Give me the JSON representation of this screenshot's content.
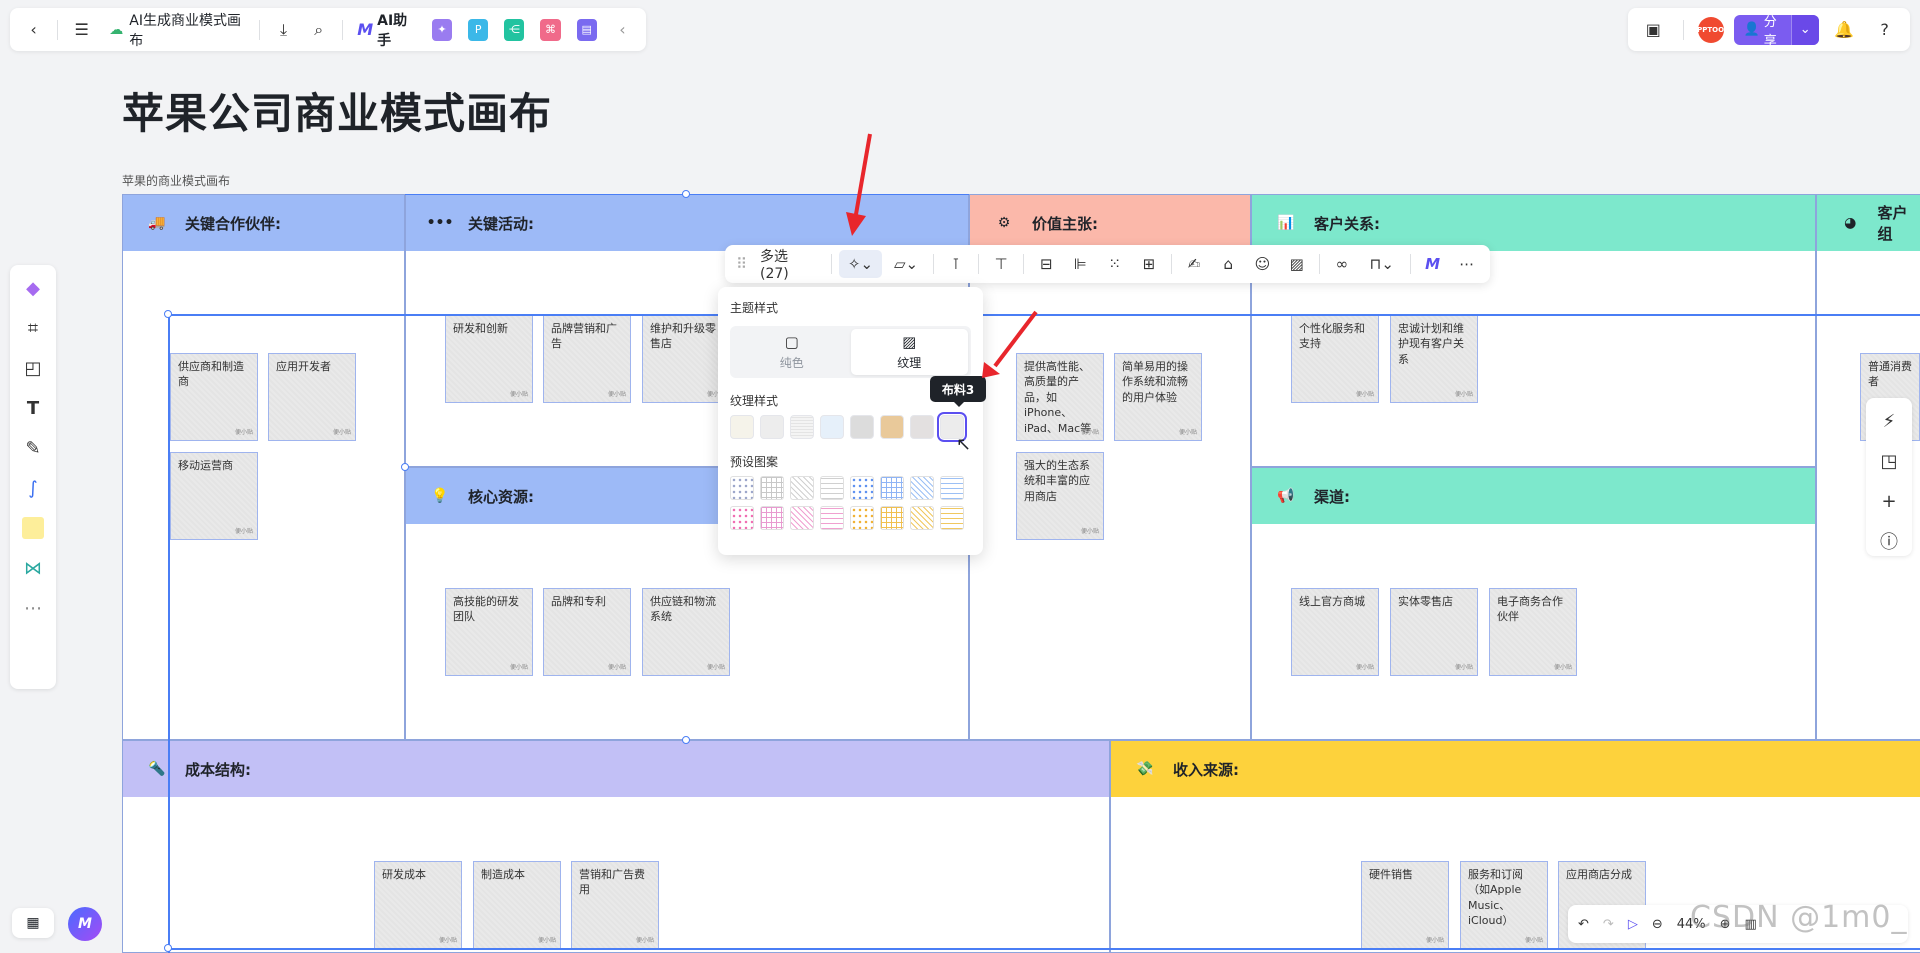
{
  "topbar": {
    "doc_title": "AI生成商业模式画布",
    "ai_label": "AI助手",
    "share_label": "分享",
    "avatar_text": "PPTOO"
  },
  "canvas": {
    "title": "苹果公司商业模式画布",
    "caption": "苹果的商业模式画布",
    "sections": {
      "partners": "关键合作伙伴:",
      "activities": "关键活动:",
      "value": "价值主张:",
      "relations": "客户关系:",
      "segments": "客户组",
      "resources": "核心资源:",
      "channels": "渠道:",
      "cost": "成本结构:",
      "revenue": "收入来源:"
    },
    "notes": {
      "n1": "供应商和制造商",
      "n2": "应用开发者",
      "n3": "移动运营商",
      "n4": "研发和创新",
      "n5": "品牌营销和广告",
      "n6": "维护和升级零售店",
      "n7": "高技能的研发团队",
      "n8": "品牌和专利",
      "n9": "供应链和物流系统",
      "n10": "提供高性能、高质量的产品，如iPhone、iPad、Mac等",
      "n11": "简单易用的操作系统和流畅的用户体验",
      "n12": "强大的生态系统和丰富的应用商店",
      "n13": "个性化服务和支持",
      "n14": "忠诚计划和维护现有客户关系",
      "n15": "线上官方商城",
      "n16": "实体零售店",
      "n17": "电子商务合作伙伴",
      "n18": "普通消费者",
      "n19": "研发成本",
      "n20": "制造成本",
      "n21": "营销和广告费用",
      "n22": "硬件销售",
      "n23": "服务和订阅（如Apple Music、iCloud）",
      "n24": "应用商店分成",
      "tag": "便小贴"
    }
  },
  "toolbar": {
    "multi_select": "多选 (27)"
  },
  "popover": {
    "theme_style": "主题样式",
    "solid": "纯色",
    "texture": "纹理",
    "texture_style": "纹理样式",
    "preset_pattern": "预设图案",
    "tooltip": "布料3",
    "texture_colors": [
      "#f5f3ea",
      "#ededed",
      "#f0f0f0",
      "#e6f0fa",
      "#dcdcdc",
      "#e9c99a",
      "#e3e0e0",
      "#ececec"
    ],
    "pattern_colors_row1": [
      "#9aa4c8",
      "#a8a8a8",
      "#b8b8b8",
      "#c0c0c0",
      "#5a8ef0",
      "#5a8ef0",
      "#7ab0f0",
      "#7ab0f0"
    ],
    "pattern_colors_row2": [
      "#f06ab0",
      "#e080c0",
      "#f090c8",
      "#e090c0",
      "#f0b030",
      "#f0b040",
      "#f0c060",
      "#f0c860"
    ]
  },
  "zoom": {
    "value": "44%"
  },
  "watermark": "CSDN @1m0_",
  "colors": {
    "blue_header": "#9dbaf7",
    "pink_header": "#fbb8aa",
    "teal_header": "#7de8cc",
    "purple_header": "#c2c0f6",
    "yellow_header": "#fdd23c",
    "accent": "#5b4ff0"
  }
}
